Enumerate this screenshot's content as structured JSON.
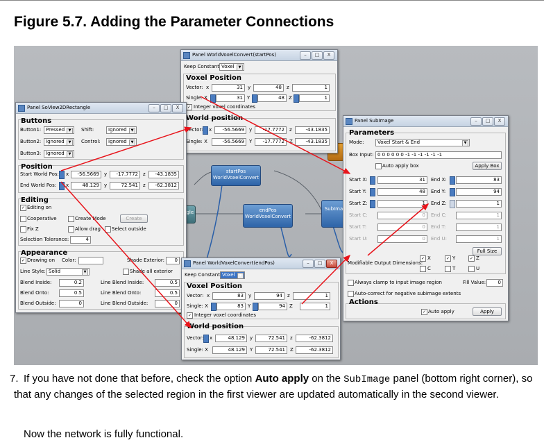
{
  "figure_title": "Figure 5.7. Adding the Parameter Connections",
  "step_number": "7.",
  "instruction": {
    "part1": "If you have not done that before, check the option ",
    "bold": "Auto apply",
    "part2": " on the ",
    "mono": "SubImage",
    "part3": " panel (bottom right corner), so that any changes of the selected region in the first viewer are updated automatically in the second viewer."
  },
  "closing_text": "Now the network is fully functional.",
  "network_nodes": {
    "startpos": {
      "name": "startPos",
      "type": "WorldVoxelConvert"
    },
    "endpos": {
      "name": "endPos",
      "type": "WorldVoxelConvert"
    },
    "subimage_partial": "SubIma",
    "rectangle_partial": "ectangle"
  },
  "startpos_panel": {
    "title": "Panel WorldVoxelConvert(startPos)",
    "keep_constant_label": "Keep Constant:",
    "keep_constant_value": "Voxel",
    "voxel_section": "Voxel Position",
    "vector_label": "Vector:",
    "vector_x_label": "x",
    "vector_x": "31",
    "vector_y_label": "y",
    "vector_y": "48",
    "vector_z_label": "z",
    "vector_z": "1",
    "single_label": "Single: X",
    "single_x": "31",
    "single_y_label": "Y",
    "single_y": "48",
    "single_z_label": "Z",
    "single_z": "1",
    "integer_label": "Integer voxel coordinates",
    "world_section": "World position",
    "w_vector_label": "Vector:",
    "w_x_label": "x",
    "w_x": "-56.5669",
    "w_y_label": "y",
    "w_y": "-17.7772",
    "w_z_label": "z",
    "w_z": "-43.1835",
    "w_single_label": "Single: X",
    "w_single_x": "-56.5669",
    "w_single_y_label": "Y",
    "w_single_y": "-17.7772",
    "w_single_z_label": "Z",
    "w_single_z": "-43.1835"
  },
  "endpos_panel": {
    "title": "Panel WorldVoxelConvert(endPos)",
    "keep_constant_label": "Keep Constant:",
    "keep_constant_value": "Voxel",
    "voxel_section": "Voxel Position",
    "vector_label": "Vector:",
    "vector_x_label": "x",
    "vector_x": "83",
    "vector_y_label": "y",
    "vector_y": "94",
    "vector_z_label": "z",
    "vector_z": "1",
    "single_label": "Single: X",
    "single_x": "83",
    "single_y_label": "Y",
    "single_y": "94",
    "single_z_label": "Z",
    "single_z": "1",
    "integer_label": "Integer voxel coordinates",
    "world_section": "World position",
    "w_vector_label": "Vector:",
    "w_x_label": "x",
    "w_x": "48.129",
    "w_y_label": "y",
    "w_y": "72.541",
    "w_z_label": "z",
    "w_z": "-62.3812",
    "w_single_label": "Single: X",
    "w_single_x": "48.129",
    "w_single_y_label": "Y",
    "w_single_y": "72.541",
    "w_single_z_label": "Z",
    "w_single_z": "-62.3812"
  },
  "soview_panel": {
    "title": "Panel SoView2DRectangle",
    "buttons_section": "Buttons",
    "button1_label": "Button1:",
    "button1_value": "Pressed",
    "shift_label": "Shift:",
    "shift_value": "Ignored",
    "button2_label": "Button2:",
    "button2_value": "Ignored",
    "control_label": "Control:",
    "control_value": "Ignored",
    "button3_label": "Button3:",
    "button3_value": "Ignored",
    "position_section": "Position",
    "start_label": "Start World Pos:",
    "start_x_label": "x",
    "start_x": "-56.5669",
    "start_y_label": "y",
    "start_y": "-17.7772",
    "start_z_label": "z",
    "start_z": "-43.1835",
    "end_label": "End World Pos:",
    "end_x_label": "x",
    "end_x": "48.129",
    "end_y_label": "y",
    "end_y": "72.541",
    "end_z_label": "z",
    "end_z": "-62.3812",
    "editing_section": "Editing",
    "editing_on": "Editing on",
    "cooperative": "Cooperative",
    "create_mode": "Create Mode",
    "create_button": "Create",
    "fix_z": "Fix Z",
    "allow_drag": "Allow drag",
    "select_outside": "Select outside",
    "selection_tolerance_label": "Selection Tolerance:",
    "selection_tolerance": "4",
    "appearance_section": "Appearance",
    "drawing_on": "Drawing on",
    "color_label": "Color:",
    "shade_exterior_label": "Shade Exterior:",
    "shade_exterior": "0",
    "line_style_label": "Line Style:",
    "line_style": "Solid",
    "shade_all_exterior": "Shade all exterior",
    "blend_inside_label": "Blend Inside:",
    "blend_inside": "0.2",
    "line_blend_inside_label": "Line Blend Inside:",
    "line_blend_inside": "0.5",
    "blend_onto_label": "Blend Onto:",
    "blend_onto": "0.5",
    "line_blend_onto_label": "Line Blend Onto:",
    "line_blend_onto": "0.5",
    "blend_outside_label": "Blend Outside:",
    "blend_outside": "0",
    "line_blend_outside_label": "Line Blend Outside:",
    "line_blend_outside": "0"
  },
  "subimage_panel": {
    "title": "Panel SubImage",
    "parameters_section": "Parameters",
    "mode_label": "Mode:",
    "mode_value": "Voxel Start & End",
    "box_input_label": "Box Input:",
    "box_input": "0 0 0 0 0 0 -1 -1 -1 -1 -1 -1",
    "auto_apply_box": "Auto apply box",
    "apply_box_button": "Apply Box",
    "start_x_label": "Start X:",
    "start_x": "31",
    "end_x_label": "End X:",
    "end_x": "83",
    "start_y_label": "Start Y:",
    "start_y": "48",
    "end_y_label": "End Y:",
    "end_y": "94",
    "start_z_label": "Start Z:",
    "start_z": "1",
    "end_z_label": "End Z:",
    "end_z": "1",
    "start_c_label": "Start C:",
    "start_c": "0",
    "end_c_label": "End C:",
    "end_c": "1",
    "start_t_label": "Start T:",
    "start_t": "0",
    "end_t_label": "End T:",
    "end_t": "1",
    "start_u_label": "Start U:",
    "start_u": "0",
    "end_u_label": "End U:",
    "end_u": "1",
    "full_size_button": "Full Size",
    "modifiable_label": "Modifiable Output Dimensions:",
    "dim_x": "X",
    "dim_y": "Y",
    "dim_z": "Z",
    "dim_c": "C",
    "dim_t": "T",
    "dim_u": "U",
    "always_clamp": "Always clamp to input image region",
    "fill_value_label": "Fill Value:",
    "fill_value": "0",
    "auto_correct": "Auto-correct for negative subimage extents",
    "actions_section": "Actions",
    "auto_apply": "Auto apply",
    "apply_button": "Apply"
  },
  "colors": {
    "arrow": "#e8141b",
    "node_blue": "#3a6fb3",
    "node_orange": "#c77b16",
    "canvas": "#b3b6ba"
  },
  "window_controls": {
    "minimize": "–",
    "maximize": "□",
    "close": "X"
  }
}
